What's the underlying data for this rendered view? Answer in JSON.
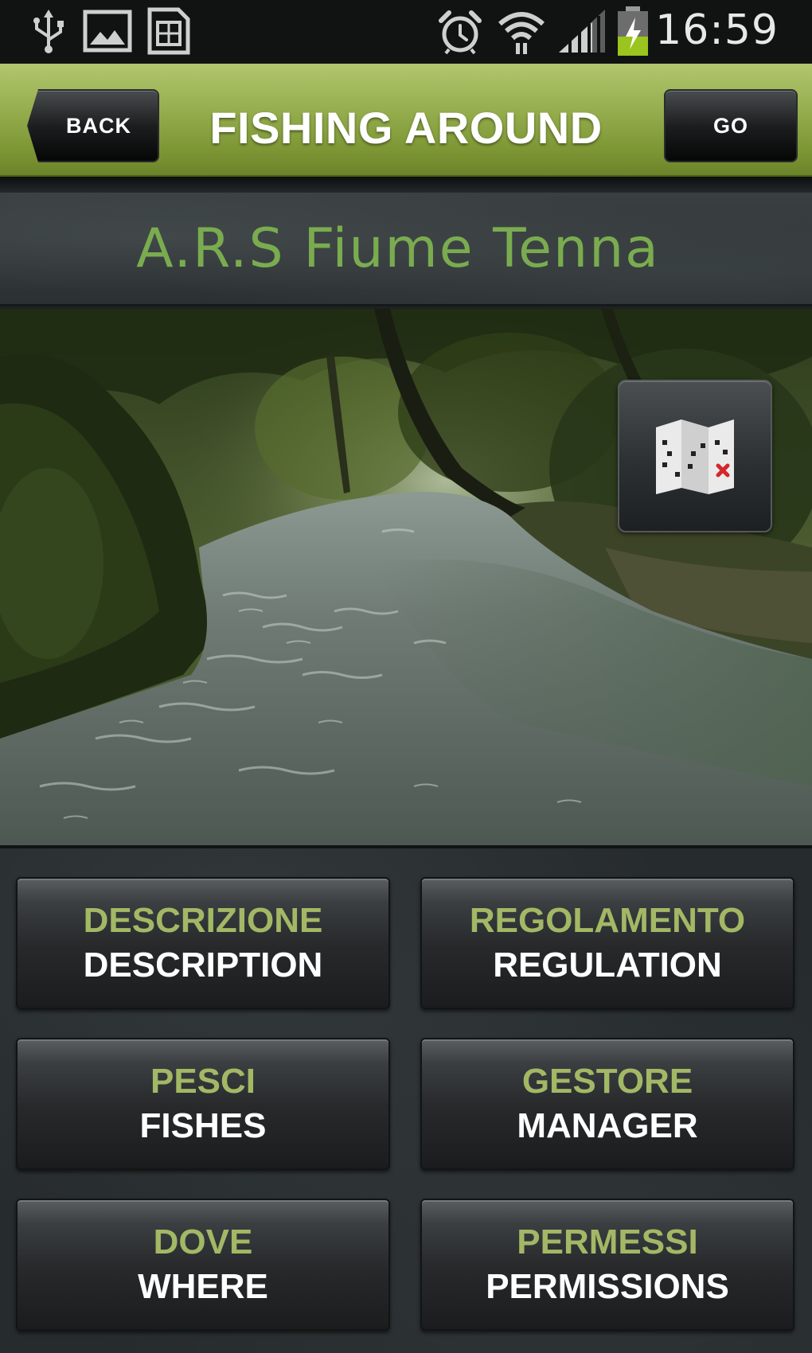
{
  "status_bar": {
    "time": "16:59",
    "icons": [
      "usb-icon",
      "image-icon",
      "sim-card-icon",
      "alarm-icon",
      "wifi-icon",
      "signal-icon",
      "battery-charging-icon"
    ]
  },
  "action_bar": {
    "back_label": "BACK",
    "title": "FISHING AROUND",
    "go_label": "GO",
    "color": "#98b050"
  },
  "place": {
    "name": "A.R.S Fiume Tenna",
    "name_color": "#7aac4f"
  },
  "photo": {
    "subject": "river-photo",
    "map_button_icon": "treasure-map-icon"
  },
  "menu": {
    "it_color": "#a3b865",
    "items": [
      {
        "it": "DESCRIZIONE",
        "en": "DESCRIPTION"
      },
      {
        "it": "REGOLAMENTO",
        "en": "REGULATION"
      },
      {
        "it": "PESCI",
        "en": "FISHES"
      },
      {
        "it": "GESTORE",
        "en": "MANAGER"
      },
      {
        "it": "DOVE",
        "en": "WHERE"
      },
      {
        "it": "PERMESSI",
        "en": "PERMISSIONS"
      }
    ]
  }
}
